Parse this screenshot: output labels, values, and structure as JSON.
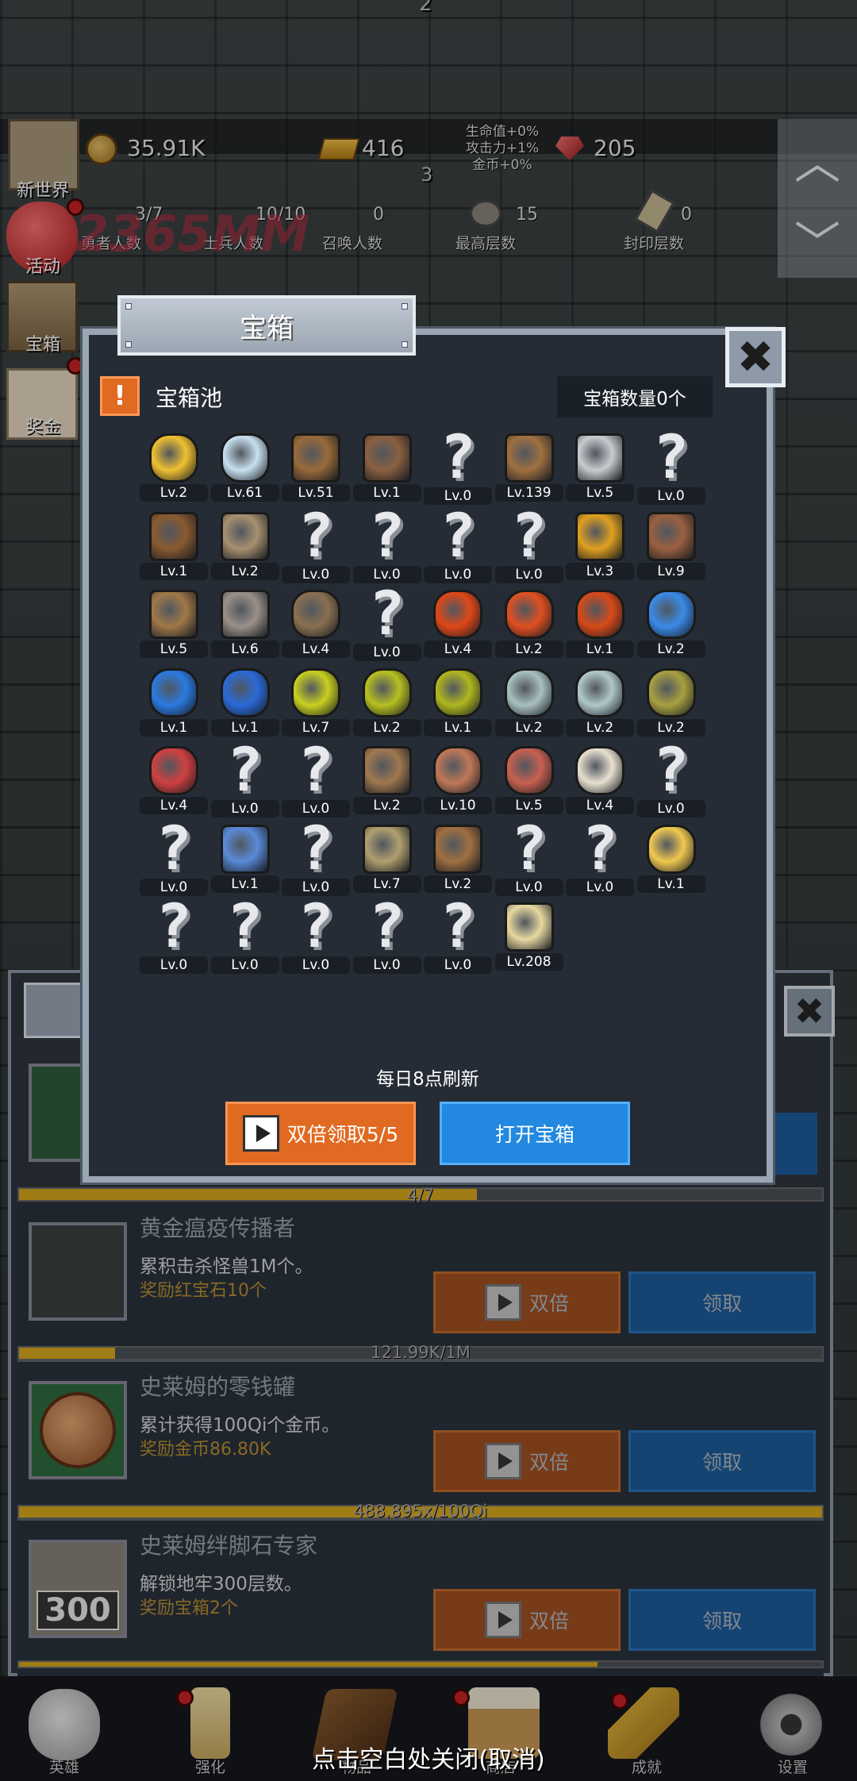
{
  "hud": {
    "floor_top": "2",
    "floor_mid": "3",
    "coins": "35.91K",
    "gold": "416",
    "ruby": "205",
    "bonus_hp": "生命值+0%",
    "bonus_atk": "攻击力+1%",
    "bonus_coin": "金币+0%",
    "heroes_value": "3/7",
    "heroes_label": "勇者人数",
    "soldiers_value": "10/10",
    "soldiers_label": "士兵人数",
    "summon_value": "0",
    "summon_label": "召唤人数",
    "max_floor_value": "15",
    "max_floor_label": "最高层数",
    "seal_value": "0",
    "seal_label": "封印层数",
    "damage_text": "2365MM"
  },
  "side_menu": [
    {
      "label": "新世界",
      "icon": "map-scroll-icon"
    },
    {
      "label": "活动",
      "icon": "heart-icon"
    },
    {
      "label": "宝箱",
      "icon": "chest-icon"
    },
    {
      "label": "奖金",
      "icon": "letter-icon"
    }
  ],
  "dialog": {
    "title": "宝箱",
    "pool_title": "宝箱池",
    "alert_symbol": "!",
    "chest_count": "宝箱数量0个",
    "close_symbol": "✖",
    "refresh_note": "每日8点刷新",
    "double_claim_label": "双倍领取5/5",
    "open_chest_label": "打开宝箱",
    "items": [
      {
        "icon": "crown-icon",
        "level": "Lv.2"
      },
      {
        "icon": "diamond-icon",
        "level": "Lv.61"
      },
      {
        "icon": "leather-armor-icon",
        "level": "Lv.51"
      },
      {
        "icon": "leather-vest-icon",
        "level": "Lv.1"
      },
      {
        "icon": "unknown-icon",
        "level": "Lv.0"
      },
      {
        "icon": "wooden-sword-icon",
        "level": "Lv.139"
      },
      {
        "icon": "steel-sword-icon",
        "level": "Lv.5"
      },
      {
        "icon": "unknown-icon",
        "level": "Lv.0"
      },
      {
        "icon": "leather-boot-icon",
        "level": "Lv.1"
      },
      {
        "icon": "cloth-boot-icon",
        "level": "Lv.2"
      },
      {
        "icon": "unknown-icon",
        "level": "Lv.0"
      },
      {
        "icon": "unknown-icon",
        "level": "Lv.0"
      },
      {
        "icon": "unknown-icon",
        "level": "Lv.0"
      },
      {
        "icon": "unknown-icon",
        "level": "Lv.0"
      },
      {
        "icon": "torch-icon",
        "level": "Lv.3"
      },
      {
        "icon": "leather-hood-icon",
        "level": "Lv.9"
      },
      {
        "icon": "dagger-icon",
        "level": "Lv.5"
      },
      {
        "icon": "iron-helmet-icon",
        "level": "Lv.6"
      },
      {
        "icon": "hammer-icon",
        "level": "Lv.4"
      },
      {
        "icon": "unknown-icon",
        "level": "Lv.0"
      },
      {
        "icon": "red-potion-small-icon",
        "level": "Lv.4"
      },
      {
        "icon": "red-potion-medium-icon",
        "level": "Lv.2"
      },
      {
        "icon": "red-potion-large-icon",
        "level": "Lv.1"
      },
      {
        "icon": "blue-potion-small-icon",
        "level": "Lv.2"
      },
      {
        "icon": "blue-potion-medium-icon",
        "level": "Lv.1"
      },
      {
        "icon": "blue-potion-large-icon",
        "level": "Lv.1"
      },
      {
        "icon": "yellow-potion-small-icon",
        "level": "Lv.7"
      },
      {
        "icon": "yellow-potion-medium-icon",
        "level": "Lv.2"
      },
      {
        "icon": "yellow-potion-large-icon",
        "level": "Lv.1"
      },
      {
        "icon": "gray-vial-icon",
        "level": "Lv.2"
      },
      {
        "icon": "gray-vial-2-icon",
        "level": "Lv.2"
      },
      {
        "icon": "olive-bottle-icon",
        "level": "Lv.2"
      },
      {
        "icon": "red-bottle-icon",
        "level": "Lv.4"
      },
      {
        "icon": "unknown-icon",
        "level": "Lv.0"
      },
      {
        "icon": "unknown-icon",
        "level": "Lv.0"
      },
      {
        "icon": "wooden-staff-icon",
        "level": "Lv.2"
      },
      {
        "icon": "ham-icon",
        "level": "Lv.10"
      },
      {
        "icon": "steak-icon",
        "level": "Lv.5"
      },
      {
        "icon": "rice-bowl-icon",
        "level": "Lv.4"
      },
      {
        "icon": "unknown-icon",
        "level": "Lv.0"
      },
      {
        "icon": "unknown-icon",
        "level": "Lv.0"
      },
      {
        "icon": "magic-wand-icon",
        "level": "Lv.1"
      },
      {
        "icon": "unknown-icon",
        "level": "Lv.0"
      },
      {
        "icon": "knight-helmet-icon",
        "level": "Lv.7"
      },
      {
        "icon": "backpack-icon",
        "level": "Lv.2"
      },
      {
        "icon": "unknown-icon",
        "level": "Lv.0"
      },
      {
        "icon": "unknown-icon",
        "level": "Lv.0"
      },
      {
        "icon": "cheese-icon",
        "level": "Lv.1"
      },
      {
        "icon": "unknown-icon",
        "level": "Lv.0"
      },
      {
        "icon": "unknown-icon",
        "level": "Lv.0"
      },
      {
        "icon": "unknown-icon",
        "level": "Lv.0"
      },
      {
        "icon": "unknown-icon",
        "level": "Lv.0"
      },
      {
        "icon": "unknown-icon",
        "level": "Lv.0"
      },
      {
        "icon": "beer-mug-icon",
        "level": "Lv.208"
      }
    ]
  },
  "achievements": {
    "close_symbol": "✖",
    "first_progress_text": "4/7",
    "first_progress": 0.57,
    "double_label": "双倍",
    "claim_label": "领取",
    "rows": [
      {
        "title": "黄金瘟疫传播者",
        "desc": "累积击杀怪兽1M个。",
        "reward": "奖励红宝石10个",
        "progress_text": "121.99K/1M",
        "progress": 0.12,
        "icon": "hooded-monster-icon"
      },
      {
        "title": "史莱姆的零钱罐",
        "desc": "累计获得100Qi个金币。",
        "reward": "奖励金币86.80K",
        "progress_text": "488.895x/100Qi",
        "progress": 1.0,
        "icon": "coin-icon"
      },
      {
        "title": "史莱姆绊脚石专家",
        "desc": "解锁地牢300层数。",
        "reward": "奖励宝箱2个",
        "progress_text": "",
        "progress": 0.72,
        "icon": "dungeon-300-icon",
        "badge": "300"
      }
    ]
  },
  "nav": [
    {
      "label": "英雄",
      "icon": "skull-icon",
      "dot": false
    },
    {
      "label": "强化",
      "icon": "candle-icon",
      "dot": true
    },
    {
      "label": "物品",
      "icon": "book-icon",
      "dot": false
    },
    {
      "label": "商店",
      "icon": "beer-icon",
      "dot": true
    },
    {
      "label": "成就",
      "icon": "key-icon",
      "dot": true
    },
    {
      "label": "设置",
      "icon": "gear-icon",
      "dot": false
    }
  ],
  "close_hint": "点击空白处关闭(取消)",
  "colors": {
    "orange": "#e06a22",
    "blue": "#2288e0",
    "gold_text": "#b88e2c"
  }
}
